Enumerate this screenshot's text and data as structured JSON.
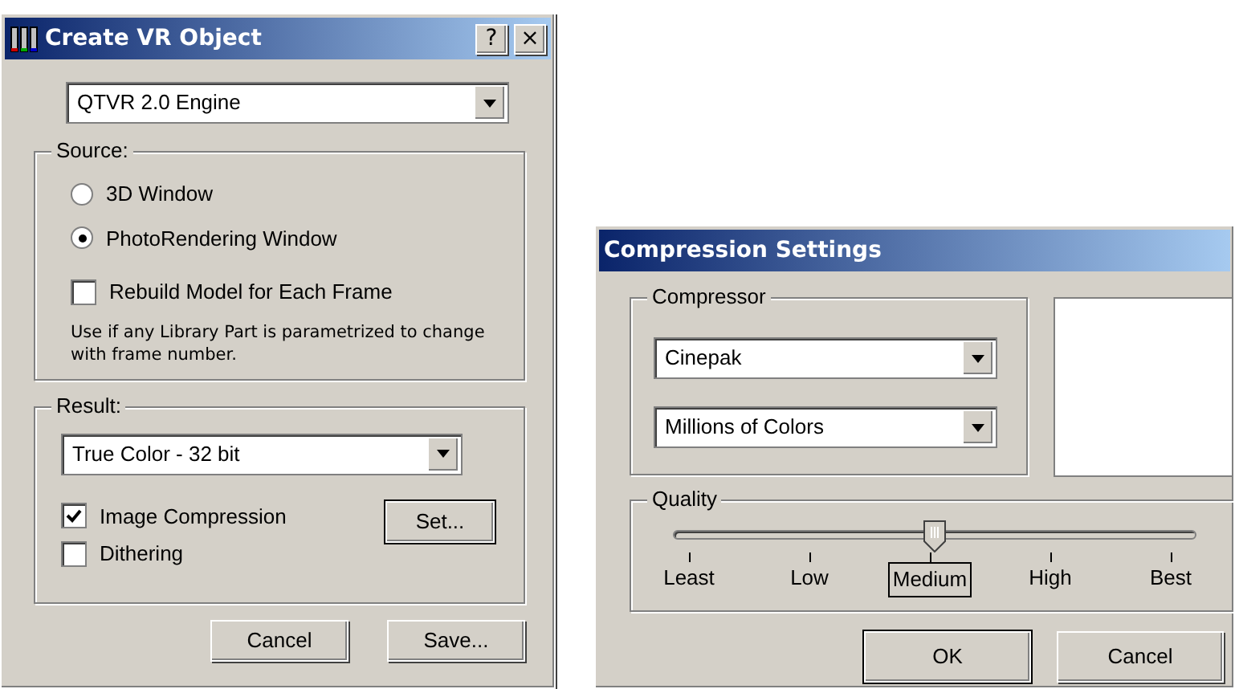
{
  "create_vr_object": {
    "title": "Create VR Object",
    "title_buttons": [
      "?",
      "×"
    ],
    "engine": "QTVR 2.0 Engine",
    "source": {
      "legend": "Source:",
      "options": [
        {
          "label": "3D Window",
          "selected": false
        },
        {
          "label": "PhotoRendering Window",
          "selected": true
        }
      ],
      "rebuild": {
        "label": "Rebuild Model for Each Frame",
        "checked": false
      },
      "note": "Use if any Library Part is parametrized to change with frame number."
    },
    "result": {
      "legend": "Result:",
      "color_depth": "True Color - 32 bit",
      "options": [
        {
          "label": "Image Compression",
          "checked": true
        },
        {
          "label": "Dithering",
          "checked": false
        }
      ],
      "set_button": "Set..."
    },
    "buttons": [
      "Cancel",
      "Save..."
    ]
  },
  "compression_settings": {
    "title": "Compression Settings",
    "compressor": {
      "legend": "Compressor",
      "codec": "Cinepak",
      "colors": "Millions of Colors"
    },
    "quality": {
      "legend": "Quality",
      "level": 0.5,
      "stops": [
        {
          "label": "Least",
          "selected": false
        },
        {
          "label": "Low",
          "selected": false
        },
        {
          "label": "Medium",
          "selected": true
        },
        {
          "label": "High",
          "selected": false
        },
        {
          "label": "Best",
          "selected": false
        }
      ]
    },
    "buttons": [
      "OK",
      "Cancel"
    ]
  }
}
